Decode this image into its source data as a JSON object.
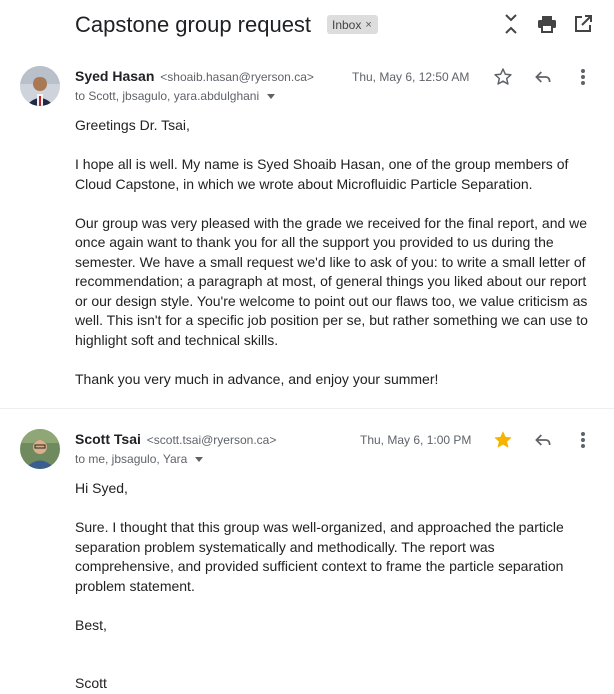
{
  "thread": {
    "subject": "Capstone group request",
    "label": "Inbox",
    "label_remove": "×"
  },
  "messages": [
    {
      "sender_name": "Syed Hasan",
      "sender_email": "<shoaib.hasan@ryerson.ca>",
      "date": "Thu, May 6, 12:50 AM",
      "recipients": "to Scott, jbsagulo, yara.abdulghani",
      "starred": false,
      "paragraphs": [
        "Greetings Dr. Tsai,",
        "I hope all is well. My name is Syed Shoaib Hasan, one of the group members of Cloud Capstone, in which we wrote about Microfluidic Particle Separation.",
        "Our group was very pleased with the grade we received for the final report, and we once again want to thank you for all the support you provided to us during the semester. We have a small request we'd like to ask of you: to write a small letter of recommendation; a paragraph at most, of general things you liked about our report or our design style. You're welcome to point out our flaws too, we value criticism as well. This isn't for a specific job position per se, but rather something we can use to highlight soft and technical skills.",
        "Thank you very much in advance, and enjoy your summer!"
      ]
    },
    {
      "sender_name": "Scott Tsai",
      "sender_email": "<scott.tsai@ryerson.ca>",
      "date": "Thu, May 6, 1:00 PM",
      "recipients": "to me, jbsagulo, Yara",
      "starred": true,
      "paragraphs": [
        "Hi Syed,",
        "Sure. I thought that this group was well-organized, and approached the particle separation problem systematically and methodically. The report was comprehensive, and provided sufficient context to frame the particle separation problem statement.",
        "Best,",
        "Scott"
      ]
    }
  ],
  "colors": {
    "star_active": "#f4b400",
    "icon": "#5f6368",
    "chip_bg": "#dddddd"
  },
  "icons": {
    "header": [
      "expand-collapse-icon",
      "print-icon",
      "open-in-new-window-icon"
    ],
    "message": [
      "star-icon",
      "reply-icon",
      "more-vert-icon"
    ]
  }
}
